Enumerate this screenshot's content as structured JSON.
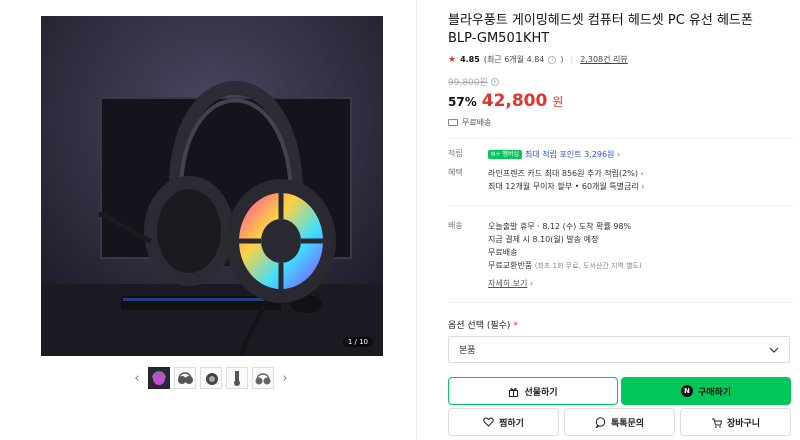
{
  "gallery": {
    "counter": "1 / 10",
    "prev_icon": "chevron-left-icon",
    "next_icon": "chevron-right-icon"
  },
  "product": {
    "title": "블라우풍트 게이밍헤드셋 컴퓨터 헤드셋 PC 유선 헤드폰 BLP-GM501KHT",
    "rating": "4.85",
    "rating_note": "(최근 6개월 4.84",
    "review_count": "2,308건 리뷰",
    "original_price": "99,800원",
    "discount": "57%",
    "price": "42,800",
    "won": "원",
    "shipping_badge": "무료배송"
  },
  "points": {
    "label": "적립",
    "badge": "N+ 멤버십",
    "text": "최대 적립 포인트 3,296원"
  },
  "benefits": {
    "label": "혜택",
    "line1": "라인프렌즈 카드 최대 856원 추가 적립(2%)",
    "line2": "최대 12개월 무이자 할부 • 60개월 특별금리"
  },
  "delivery": {
    "label": "배송",
    "line1": "오늘출발 휴무 · 8.12 (수) 도착 확률 98%",
    "line2": "지금 결제 시 8.10(월) 발송 예정",
    "line3": "무료배송",
    "line4": "무료교환반품",
    "line4_sub": "(최초 1회 무료, 도서산간 지역 별도)",
    "more": "자세히 보기"
  },
  "options": {
    "label": "옵션 선택 (필수)",
    "required_mark": "*",
    "selected": "본품"
  },
  "buttons": {
    "gift": "선물하기",
    "buy": "구매하기",
    "buy_icon_text": "N",
    "wish": "찜하기",
    "talk": "톡톡문의",
    "cart": "장바구니"
  },
  "colors": {
    "accent": "#03c75a",
    "price": "#e5322d",
    "image_bg": "#2a2838"
  }
}
